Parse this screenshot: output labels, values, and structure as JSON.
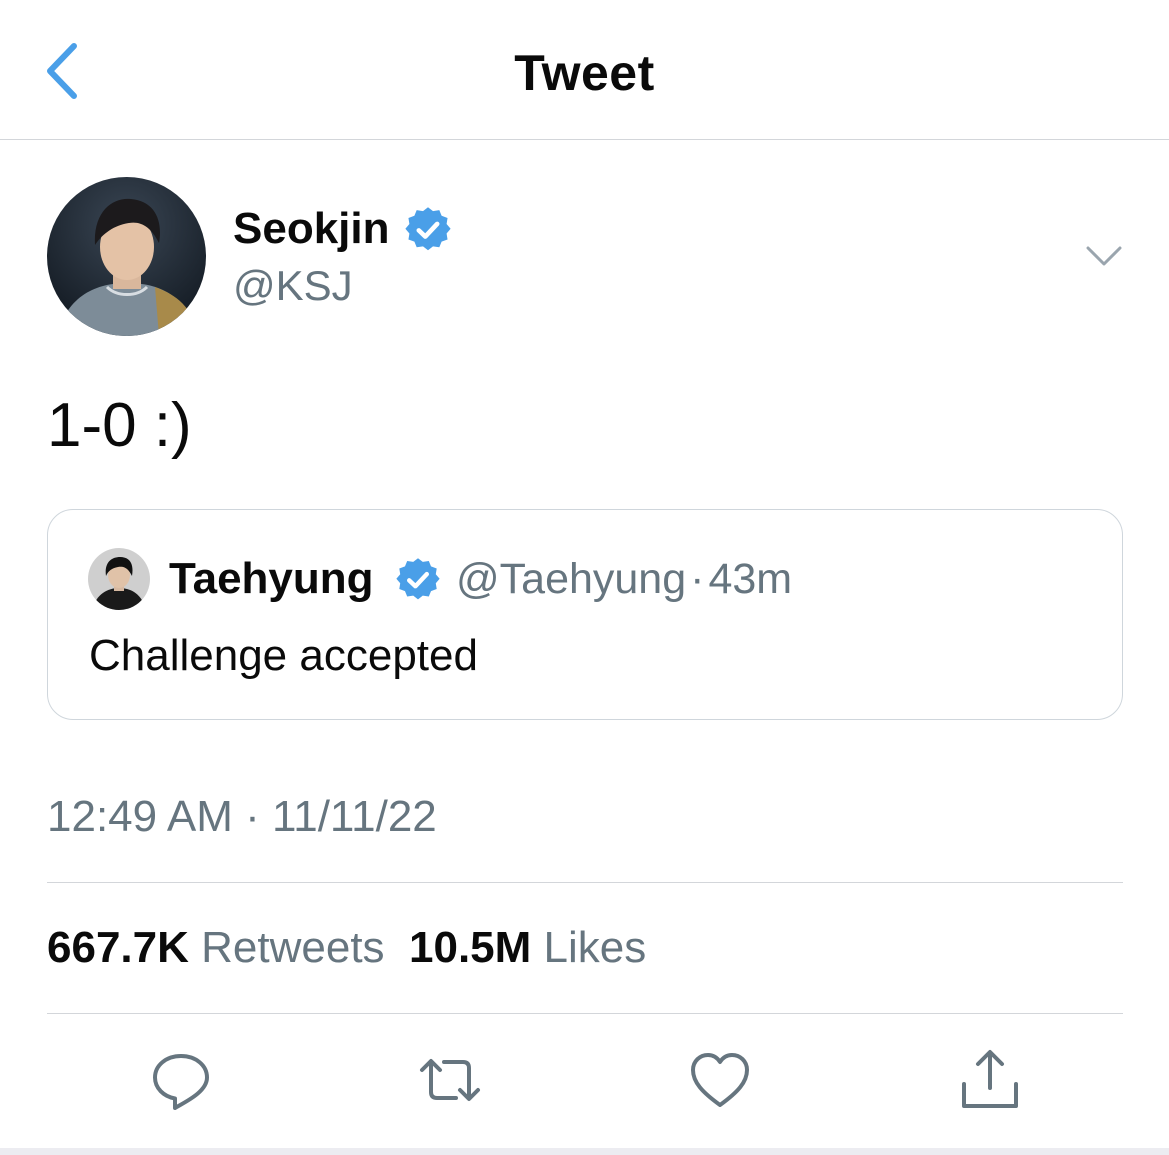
{
  "nav": {
    "title": "Tweet",
    "back_icon": "chevron-left-icon"
  },
  "author": {
    "name": "Seokjin",
    "handle": "@KSJ",
    "verified_icon": "verified-badge-icon"
  },
  "tweet": {
    "text": "1-0 :)"
  },
  "quote": {
    "name": "Taehyung",
    "handle": "@Taehyung",
    "separator": "·",
    "time": "43m",
    "text": "Challenge accepted"
  },
  "timestamp": {
    "time": "12:49 AM",
    "separator": "·",
    "date": "11/11/22"
  },
  "stats": {
    "retweets_count": "667.7K",
    "retweets_label": "Retweets",
    "likes_count": "10.5M",
    "likes_label": "Likes"
  },
  "actions": [
    "reply-icon",
    "retweet-icon",
    "like-icon",
    "share-icon"
  ],
  "colors": {
    "accent": "#4a9fe8",
    "secondary_text": "#66757f",
    "primary_text": "#0a0a0a",
    "divider": "#d3d6da"
  }
}
